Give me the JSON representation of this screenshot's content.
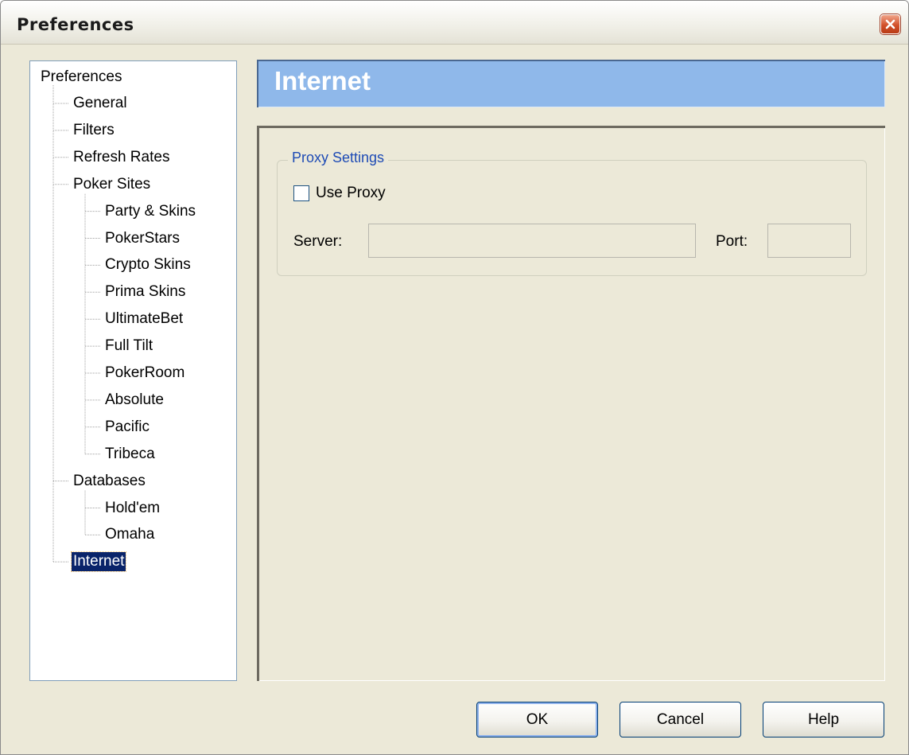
{
  "window": {
    "title": "Preferences"
  },
  "tree": {
    "root": "Preferences",
    "items": [
      {
        "label": "General",
        "level": 1
      },
      {
        "label": "Filters",
        "level": 1
      },
      {
        "label": "Refresh Rates",
        "level": 1
      },
      {
        "label": "Poker Sites",
        "level": 1
      },
      {
        "label": "Party & Skins",
        "level": 2
      },
      {
        "label": "PokerStars",
        "level": 2
      },
      {
        "label": "Crypto Skins",
        "level": 2
      },
      {
        "label": "Prima Skins",
        "level": 2
      },
      {
        "label": "UltimateBet",
        "level": 2
      },
      {
        "label": "Full Tilt",
        "level": 2
      },
      {
        "label": "PokerRoom",
        "level": 2
      },
      {
        "label": "Absolute",
        "level": 2
      },
      {
        "label": "Pacific",
        "level": 2
      },
      {
        "label": "Tribeca",
        "level": 2
      },
      {
        "label": "Databases",
        "level": 1
      },
      {
        "label": "Hold'em",
        "level": 2
      },
      {
        "label": "Omaha",
        "level": 2
      },
      {
        "label": "Internet",
        "level": 1,
        "selected": true
      }
    ]
  },
  "page": {
    "header": "Internet",
    "proxy_group": {
      "legend": "Proxy Settings",
      "use_proxy_label": "Use Proxy",
      "use_proxy_checked": false,
      "server_label": "Server:",
      "server_value": "",
      "port_label": "Port:",
      "port_value": ""
    }
  },
  "buttons": {
    "ok": "OK",
    "cancel": "Cancel",
    "help": "Help"
  },
  "colors": {
    "header_band": "#8fb8ea",
    "selection": "#0a246a",
    "group_legend": "#1e4bb5"
  }
}
